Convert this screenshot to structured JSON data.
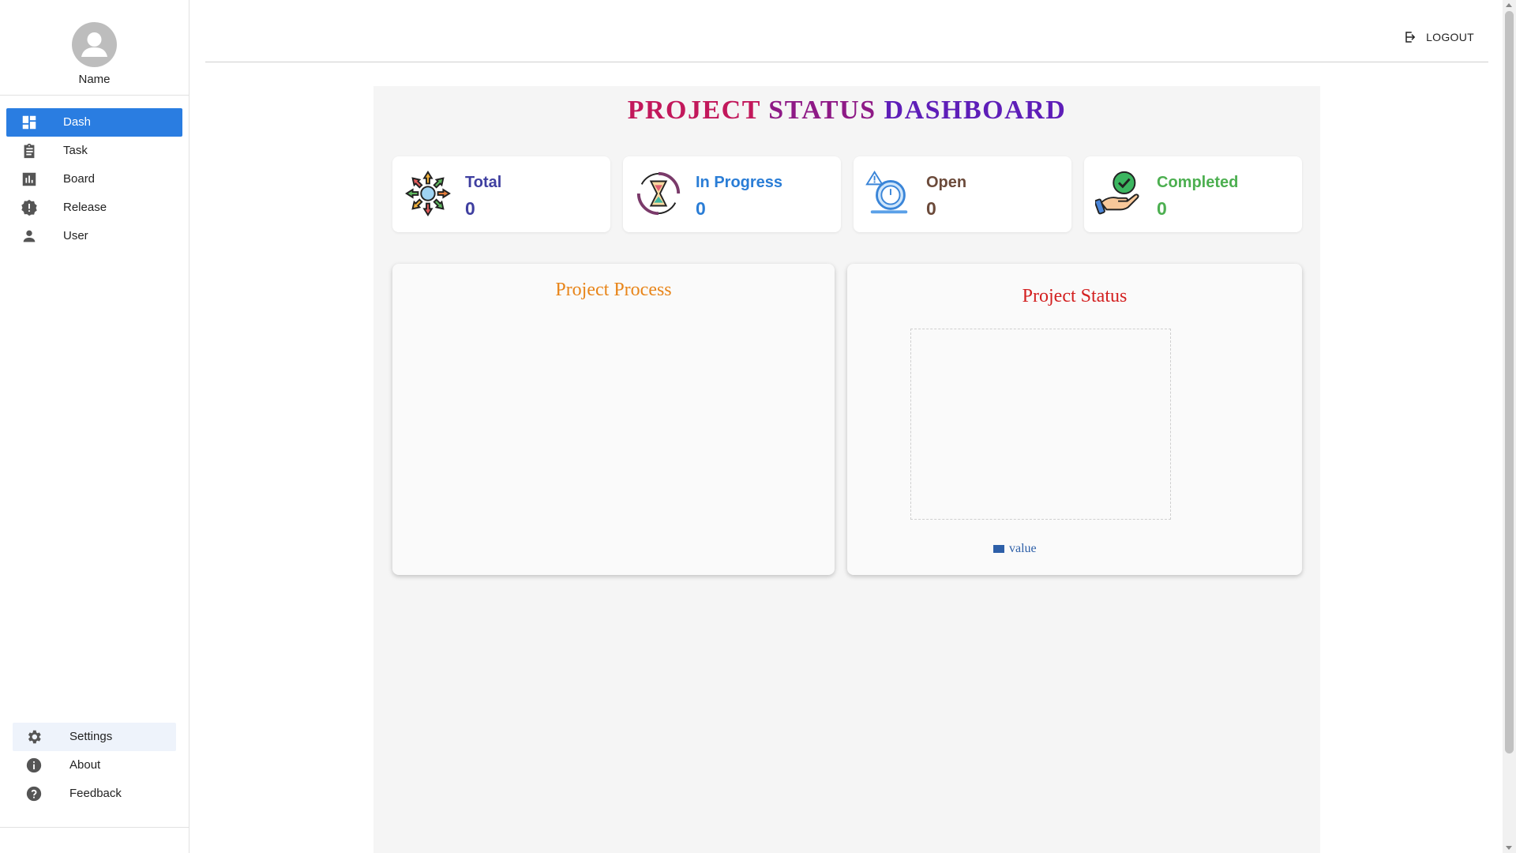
{
  "sidebar": {
    "profile_name": "Name",
    "items": [
      {
        "label": "Dash",
        "icon": "dashboard-icon"
      },
      {
        "label": "Task",
        "icon": "clipboard-icon"
      },
      {
        "label": "Board",
        "icon": "bar-chart-icon"
      },
      {
        "label": "Release",
        "icon": "release-badge-icon"
      },
      {
        "label": "User",
        "icon": "person-icon"
      }
    ],
    "bottom_items": [
      {
        "label": "Settings",
        "icon": "gear-icon"
      },
      {
        "label": "About",
        "icon": "info-icon"
      },
      {
        "label": "Feedback",
        "icon": "help-icon"
      }
    ],
    "active_color": "#2a7de1"
  },
  "header": {
    "logout_label": "LOGOUT"
  },
  "dashboard": {
    "title_part1": "PROJECT",
    "title_part2": "STATUS",
    "title_part3": "DASHBOARD",
    "cards": [
      {
        "label": "Total",
        "value": "0",
        "color": "#3f3fa0"
      },
      {
        "label": "In Progress",
        "value": "0",
        "color": "#2a7dd6"
      },
      {
        "label": "Open",
        "value": "0",
        "color": "#6b4a3a"
      },
      {
        "label": "Completed",
        "value": "0",
        "color": "#4caf50"
      }
    ],
    "process_title": "Project Process",
    "status_title": "Project Status"
  },
  "chart_data": {
    "type": "bar",
    "title": "Project Status",
    "series": [
      {
        "name": "value",
        "values": []
      }
    ]
  }
}
